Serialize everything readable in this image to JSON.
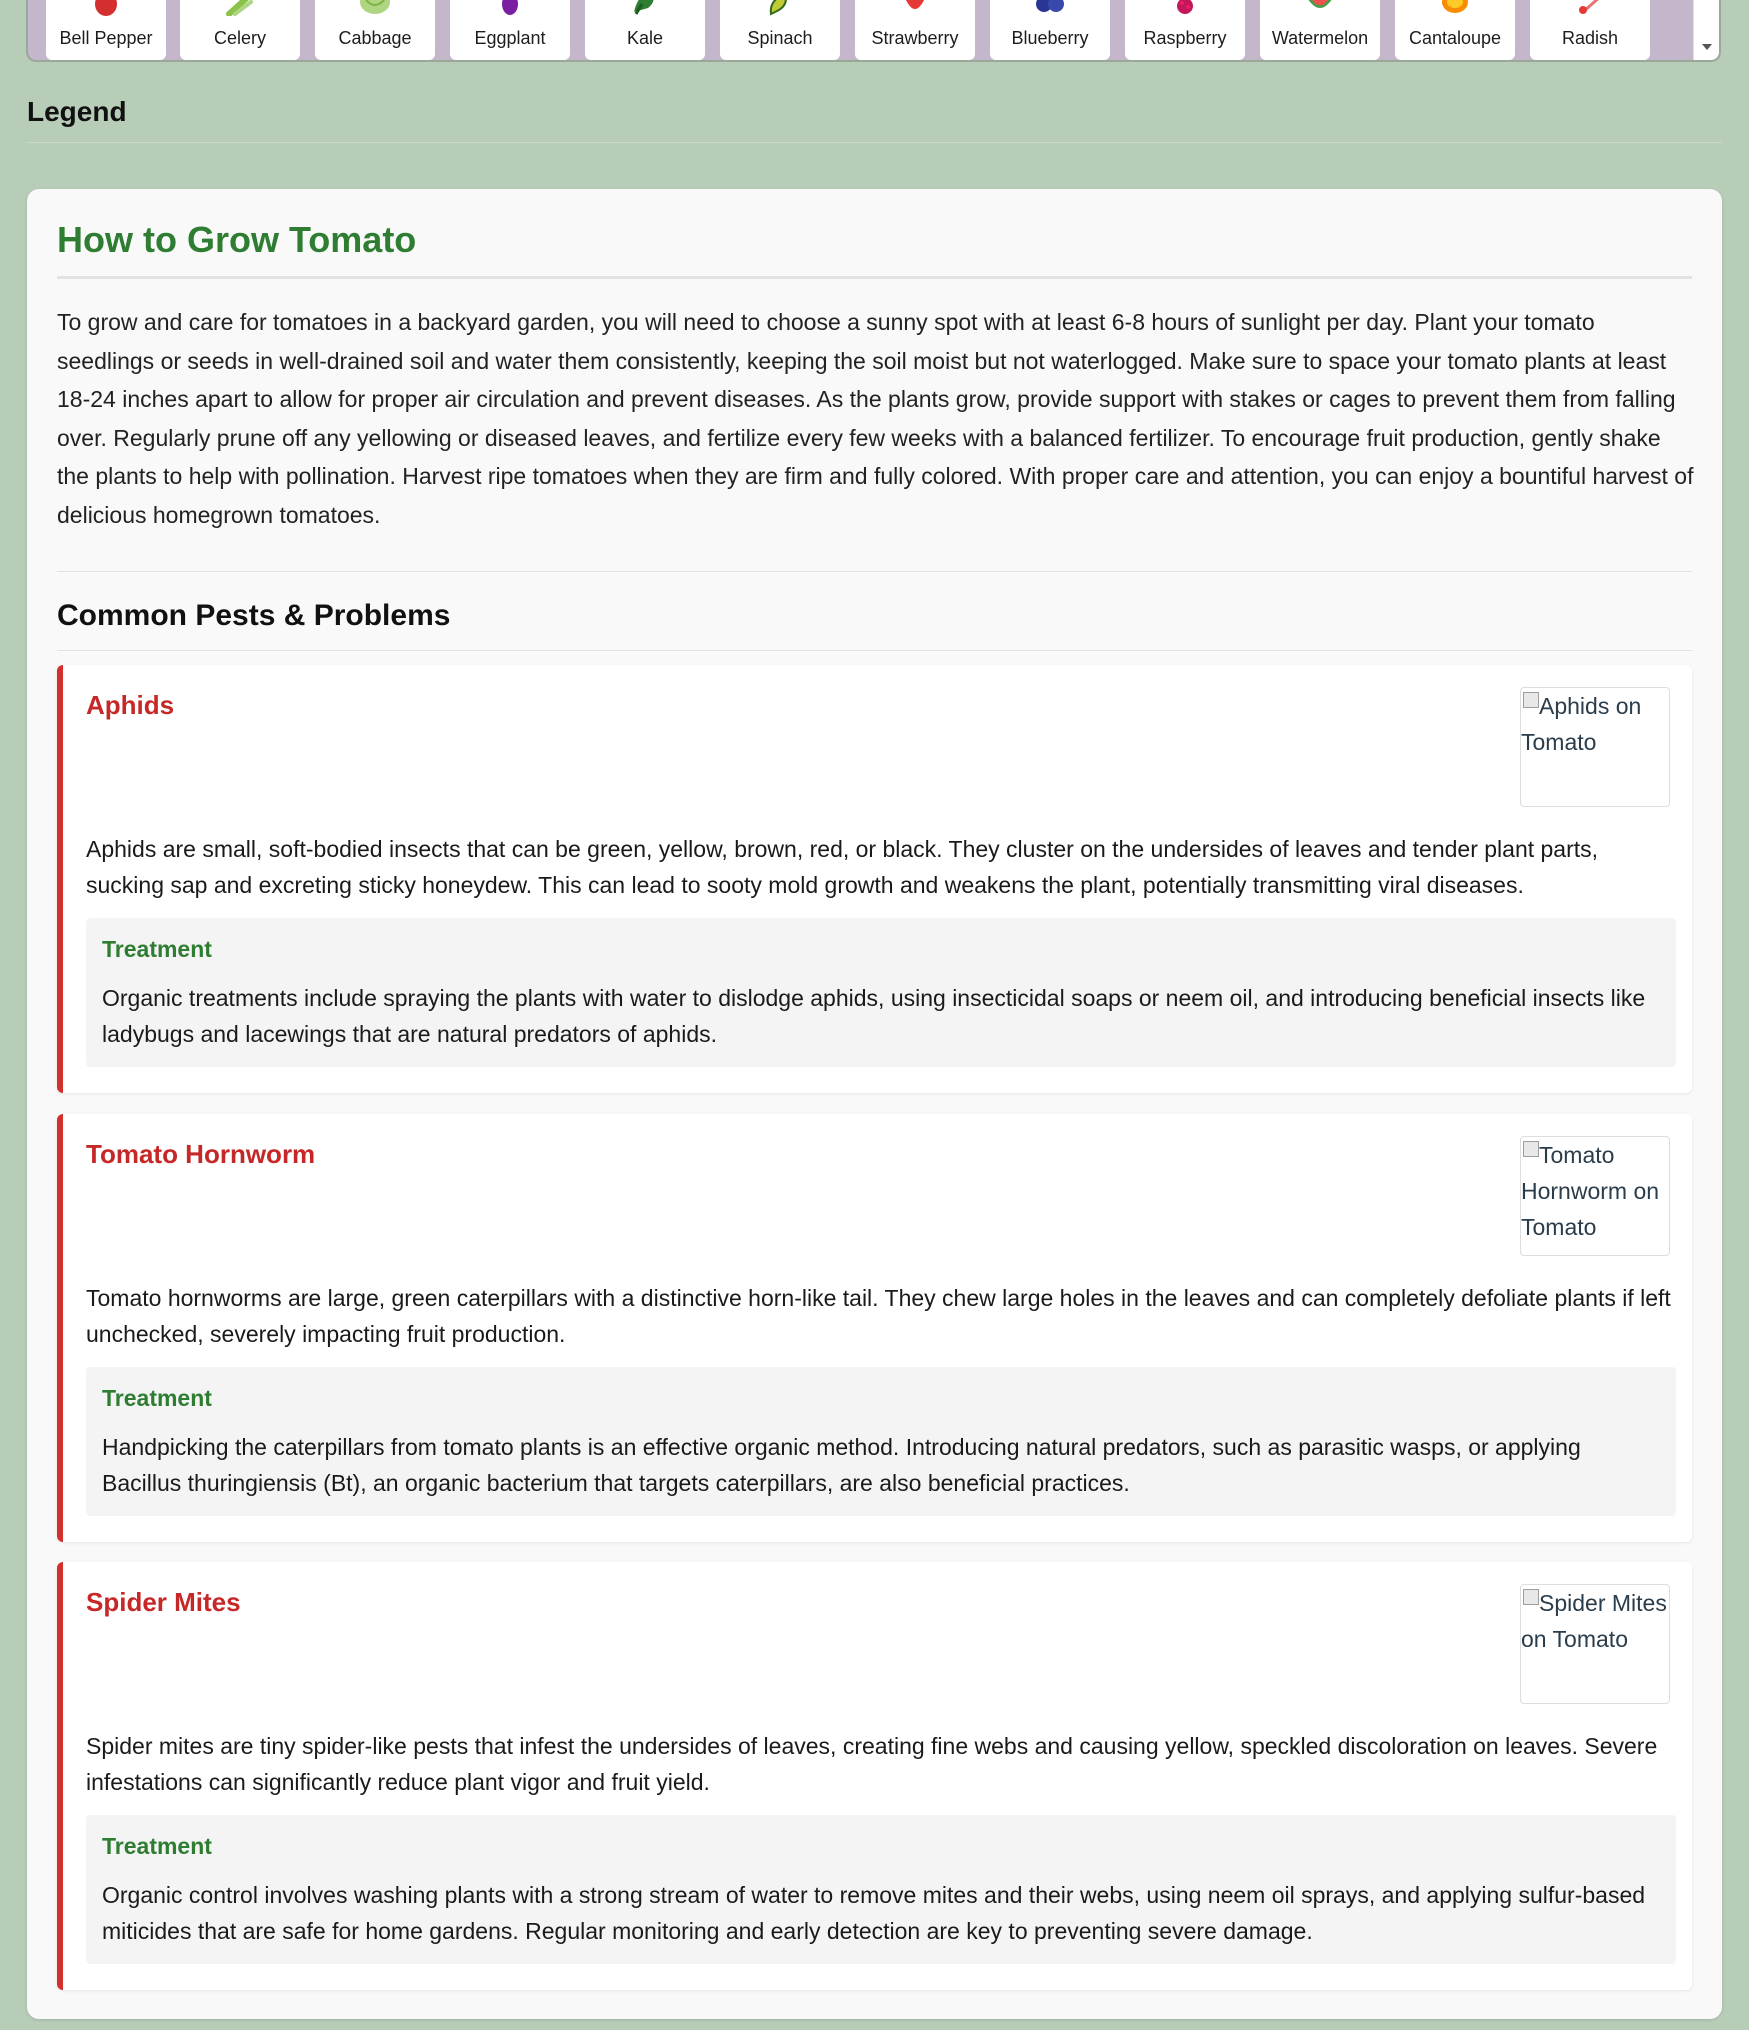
{
  "plants": [
    {
      "label": "Bell Pepper",
      "icon": "bell-pepper-icon",
      "color": "#d32f2f"
    },
    {
      "label": "Celery",
      "icon": "celery-icon",
      "color": "#8bc34a"
    },
    {
      "label": "Cabbage",
      "icon": "cabbage-icon",
      "color": "#aed581"
    },
    {
      "label": "Eggplant",
      "icon": "eggplant-icon",
      "color": "#7b1fa2"
    },
    {
      "label": "Kale",
      "icon": "kale-icon",
      "color": "#2e7d32"
    },
    {
      "label": "Spinach",
      "icon": "spinach-icon",
      "color": "#558b2f"
    },
    {
      "label": "Strawberry",
      "icon": "strawberry-icon",
      "color": "#e53935"
    },
    {
      "label": "Blueberry",
      "icon": "blueberry-icon",
      "color": "#283593"
    },
    {
      "label": "Raspberry",
      "icon": "raspberry-icon",
      "color": "#c2185b"
    },
    {
      "label": "Watermelon",
      "icon": "watermelon-icon",
      "color": "#43a047"
    },
    {
      "label": "Cantaloupe",
      "icon": "cantaloupe-icon",
      "color": "#fb8c00"
    },
    {
      "label": "Radish",
      "icon": "radish-icon",
      "color": "#e57373"
    }
  ],
  "legend": {
    "heading": "Legend"
  },
  "guide": {
    "title": "How to Grow Tomato",
    "intro": "To grow and care for tomatoes in a backyard garden, you will need to choose a sunny spot with at least 6-8 hours of sunlight per day. Plant your tomato seedlings or seeds in well-drained soil and water them consistently, keeping the soil moist but not waterlogged. Make sure to space your tomato plants at least 18-24 inches apart to allow for proper air circulation and prevent diseases. As the plants grow, provide support with stakes or cages to prevent them from falling over. Regularly prune off any yellowing or diseased leaves, and fertilize every few weeks with a balanced fertilizer. To encourage fruit production, gently shake the plants to help with pollination. Harvest ripe tomatoes when they are firm and fully colored. With proper care and attention, you can enjoy a bountiful harvest of delicious homegrown tomatoes.",
    "pests_heading": "Common Pests & Problems"
  },
  "pests": [
    {
      "name": "Aphids",
      "image_alt": "Aphids on Tomato",
      "description": "Aphids are small, soft-bodied insects that can be green, yellow, brown, red, or black. They cluster on the undersides of leaves and tender plant parts, sucking sap and excreting sticky honeydew. This can lead to sooty mold growth and weakens the plant, potentially transmitting viral diseases.",
      "treatment_label": "Treatment",
      "treatment": "Organic treatments include spraying the plants with water to dislodge aphids, using insecticidal soaps or neem oil, and introducing beneficial insects like ladybugs and lacewings that are natural predators of aphids."
    },
    {
      "name": "Tomato Hornworm",
      "image_alt": "Tomato Hornworm on Tomato",
      "description": "Tomato hornworms are large, green caterpillars with a distinctive horn-like tail. They chew large holes in the leaves and can completely defoliate plants if left unchecked, severely impacting fruit production.",
      "treatment_label": "Treatment",
      "treatment": "Handpicking the caterpillars from tomato plants is an effective organic method. Introducing natural predators, such as parasitic wasps, or applying Bacillus thuringiensis (Bt), an organic bacterium that targets caterpillars, are also beneficial practices."
    },
    {
      "name": "Spider Mites",
      "image_alt": "Spider Mites on Tomato",
      "description": "Spider mites are tiny spider-like pests that infest the undersides of leaves, creating fine webs and causing yellow, speckled discoloration on leaves. Severe infestations can significantly reduce plant vigor and fruit yield.",
      "treatment_label": "Treatment",
      "treatment": "Organic control involves washing plants with a strong stream of water to remove mites and their webs, using neem oil sprays, and applying sulfur-based miticides that are safe for home gardens. Regular monitoring and early detection are key to preventing severe damage."
    }
  ],
  "colors": {
    "accent_green": "#2e7d32",
    "pest_red": "#c62828",
    "page_background": "#b7cdb8",
    "strip_background": "#c4b6cb"
  }
}
